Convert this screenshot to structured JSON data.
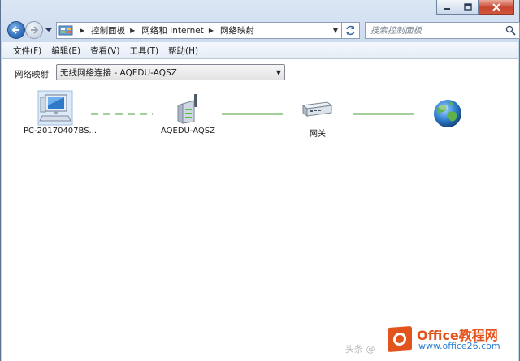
{
  "window": {
    "caption_buttons": [
      "minimize",
      "restore",
      "close"
    ]
  },
  "address_bar": {
    "breadcrumbs": [
      "控制面板",
      "网络和 Internet",
      "网络映射"
    ],
    "icon": "control-panel-icon"
  },
  "search": {
    "placeholder": "搜索控制面板"
  },
  "menu": {
    "items": [
      "文件(F)",
      "编辑(E)",
      "查看(V)",
      "工具(T)",
      "帮助(H)"
    ]
  },
  "map": {
    "label": "网络映射",
    "selected_connection": "无线网络连接 - AQEDU-AQSZ",
    "nodes": [
      {
        "label": "PC-20170407BS...",
        "icon": "computer-icon"
      },
      {
        "label": "AQEDU-AQSZ",
        "icon": "wireless-router-icon"
      },
      {
        "label": "网关",
        "icon": "gateway-icon"
      },
      {
        "label": "",
        "icon": "internet-globe-icon"
      }
    ],
    "links": [
      {
        "style": "dashed",
        "color": "#a6cf9e"
      },
      {
        "style": "solid",
        "color": "#a6cf9e"
      },
      {
        "style": "solid",
        "color": "#a6cf9e"
      }
    ]
  },
  "watermark": {
    "brand": "Office教程网",
    "url": "www.office26.com",
    "faint_text": "头条 @"
  },
  "colors": {
    "accent_orange": "#e3541c",
    "link_green": "#a6cf9e",
    "url_blue": "#2c7fd1"
  }
}
